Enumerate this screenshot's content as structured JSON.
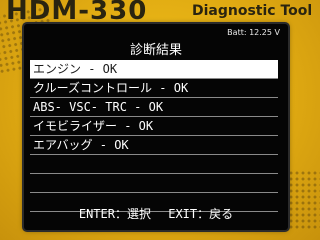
{
  "device": {
    "model": "HDM-330",
    "title": "Diagnostic Tool"
  },
  "screen": {
    "status": "Batt: 12.25 V",
    "title": "診断結果",
    "items": [
      {
        "label": "エンジン - OK",
        "selected": true
      },
      {
        "label": "クルーズコントロール - OK",
        "selected": false
      },
      {
        "label": "ABS- VSC- TRC - OK",
        "selected": false
      },
      {
        "label": "イモビライザー - OK",
        "selected": false
      },
      {
        "label": "エアバッグ - OK",
        "selected": false
      },
      {
        "label": "",
        "selected": false
      },
      {
        "label": "",
        "selected": false
      },
      {
        "label": "",
        "selected": false
      }
    ],
    "footer": {
      "enter": "ENTER：選択",
      "exit": "EXIT：戻る"
    }
  },
  "colors": {
    "device_body": "#e8b415",
    "screen_bg": "#050505",
    "selected_bg": "#ffffff",
    "text": "#ffffff"
  }
}
